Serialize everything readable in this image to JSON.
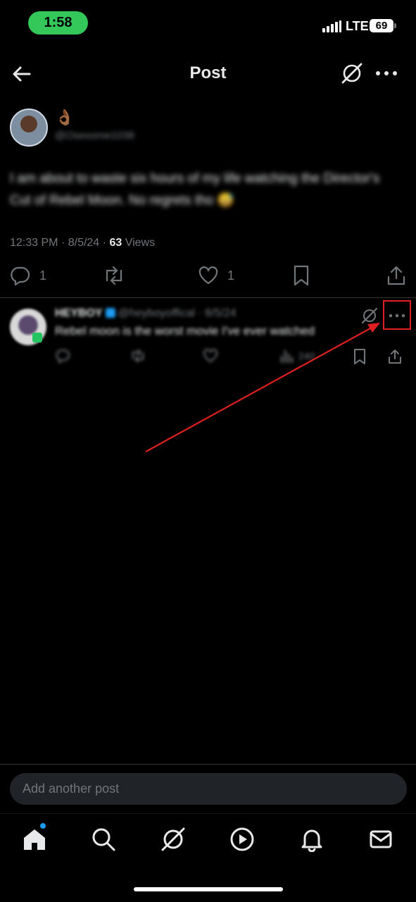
{
  "status_bar": {
    "time": "1:58",
    "network": "LTE",
    "battery": "69"
  },
  "header": {
    "title": "Post"
  },
  "post": {
    "display_name": "👌🏾",
    "handle": "@Osesome1038",
    "text": "I am about to waste six hours of my life watching the Director's Cut of Rebel Moon. No regrets tho 😅",
    "time": "12:33 PM",
    "date": "8/5/24",
    "views_count": "63",
    "views_label": "Views",
    "replies": "1",
    "likes": "1"
  },
  "reply": {
    "name": "HEYBOY",
    "handle_date": "@heyboyoffical · 8/5/24",
    "text": "Rebel moon is the worst movie I've ever watched",
    "views": "240"
  },
  "composer": {
    "placeholder": "Add another post"
  },
  "annotation": {
    "color": "#e02020"
  },
  "tabs": [
    "home-icon",
    "search-icon",
    "grok-icon",
    "video-icon",
    "notifications-icon",
    "messages-icon"
  ]
}
